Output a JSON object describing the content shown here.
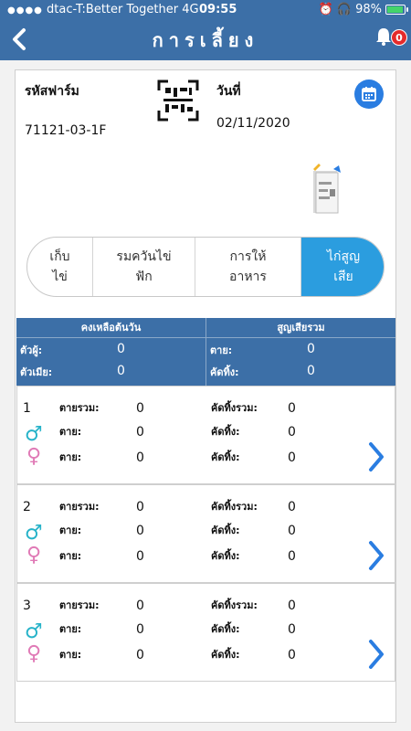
{
  "status_bar": {
    "carrier": "dtac-T:Better Together",
    "network": "4G",
    "time": "09:55",
    "battery": "98%",
    "battery_level": 0.98
  },
  "header": {
    "title": "การเลี้ยง",
    "notification_count": "0"
  },
  "farm": {
    "code_label": "รหัสฟาร์ม",
    "code_value": "71121-03-1F",
    "date_label": "วันที่",
    "date_value": "02/11/2020"
  },
  "segments": [
    {
      "label": "เก็บ\nไข่",
      "active": false
    },
    {
      "label": "รมควันไข่\nฟัก",
      "active": false
    },
    {
      "label": "การให้\nอาหาร",
      "active": false
    },
    {
      "label": "ไก่สูญ\nเสีย",
      "active": true
    }
  ],
  "summary": {
    "left_header": "คงเหลือต้นวัน",
    "right_header": "สูญเสียรวม",
    "male_label": "ตัวผู้:",
    "male_value": "0",
    "female_label": "ตัวเมีย:",
    "female_value": "0",
    "dead_label": "ตาย:",
    "dead_value": "0",
    "culled_label": "คัดทิ้ง:",
    "culled_value": "0"
  },
  "cards": [
    {
      "number": "1",
      "total_dead_label": "ตายรวม:",
      "total_dead": "0",
      "male_dead_label": "ตาย:",
      "male_dead": "0",
      "female_dead_label": "ตาย:",
      "female_dead": "0",
      "total_culled_label": "คัดทิ้งรวม:",
      "total_culled": "0",
      "male_culled_label": "คัดทิ้ง:",
      "male_culled": "0",
      "female_culled_label": "คัดทิ้ง:",
      "female_culled": "0"
    },
    {
      "number": "2",
      "total_dead_label": "ตายรวม:",
      "total_dead": "0",
      "male_dead_label": "ตาย:",
      "male_dead": "0",
      "female_dead_label": "ตาย:",
      "female_dead": "0",
      "total_culled_label": "คัดทิ้งรวม:",
      "total_culled": "0",
      "male_culled_label": "คัดทิ้ง:",
      "male_culled": "0",
      "female_culled_label": "คัดทิ้ง:",
      "female_culled": "0"
    },
    {
      "number": "3",
      "total_dead_label": "ตายรวม:",
      "total_dead": "0",
      "male_dead_label": "ตาย:",
      "male_dead": "0",
      "female_dead_label": "ตาย:",
      "female_dead": "0",
      "total_culled_label": "คัดทิ้งรวม:",
      "total_culled": "0",
      "male_culled_label": "คัดทิ้ง:",
      "male_culled": "0",
      "female_culled_label": "คัดทิ้ง:",
      "female_culled": "0"
    }
  ],
  "icons": {
    "back": "chevron-left-icon",
    "bell": "bell-icon",
    "qr": "qr-code-icon",
    "calendar": "calendar-icon",
    "document": "document-icon",
    "male": "male-icon",
    "female": "female-icon",
    "next": "chevron-right-icon"
  },
  "colors": {
    "header_bg": "#3c6fa7",
    "accent": "#2b9ddf",
    "badge": "#e52b2b",
    "male": "#27b3c9",
    "female": "#e07ab6"
  }
}
